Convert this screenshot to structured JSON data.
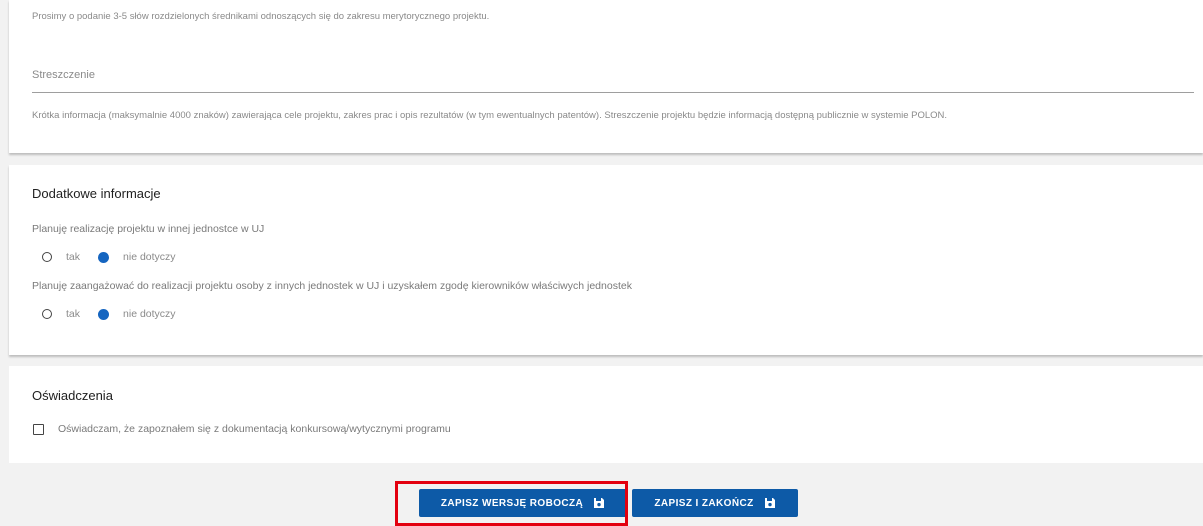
{
  "keywords": {
    "hint": "Prosimy o podanie 3-5 słów rozdzielonych średnikami odnoszących się do zakresu merytorycznego projektu."
  },
  "abstract": {
    "label": "Streszczenie",
    "value": "",
    "hint": "Krótka informacja (maksymalnie 4000 znaków) zawierająca cele projektu, zakres prac i opis rezultatów (w tym ewentualnych patentów). Streszczenie projektu będzie informacją dostępną publicznie w systemie POLON."
  },
  "additional": {
    "title": "Dodatkowe informacje",
    "questions": [
      {
        "text": "Planuję realizację projektu w innej jednostce w UJ",
        "options": [
          "tak",
          "nie dotyczy"
        ],
        "selected": "nie dotyczy"
      },
      {
        "text": "Planuję zaangażować do realizacji projektu osoby z innych jednostek w UJ i uzyskałem zgodę kierowników właściwych jednostek",
        "options": [
          "tak",
          "nie dotyczy"
        ],
        "selected": "nie dotyczy"
      }
    ]
  },
  "declarations": {
    "title": "Oświadczenia",
    "items": [
      {
        "label": "Oświadczam, że zapoznałem się z dokumentacją konkursową/wytycznymi programu",
        "checked": false
      }
    ]
  },
  "actions": {
    "save_draft": "ZAPISZ WERSJĘ ROBOCZĄ",
    "save_finish": "ZAPISZ I ZAKOŃCZ",
    "icon": "save-icon"
  },
  "colors": {
    "primary": "#0d5aa7",
    "radio_checked": "#1565c0",
    "highlight": "#e3000f",
    "background": "#f2f2f2"
  }
}
